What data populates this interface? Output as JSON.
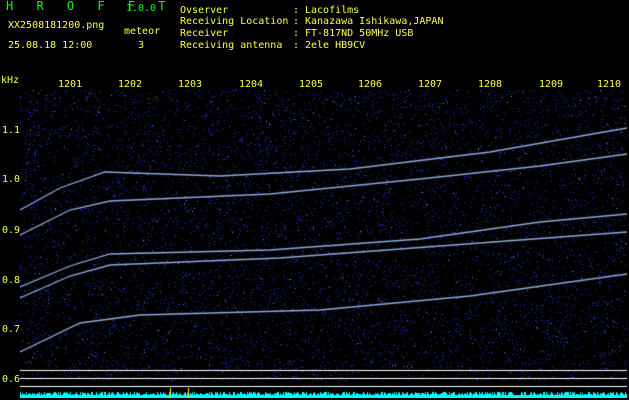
{
  "header": {
    "app_name": "H R O F F T",
    "version": "1.0.0",
    "filename": "XX2508181200.png",
    "meteor_label": "meteor",
    "timestamp": "25.08.18 12:00",
    "meteor_count": "3"
  },
  "info": [
    {
      "label": "Ovserver",
      "value": "Lacofilms"
    },
    {
      "label": "Receiving Location",
      "value": "Kanazawa Ishikawa,JAPAN"
    },
    {
      "label": "Receiver",
      "value": "FT-817ND 50MHz USB"
    },
    {
      "label": "Receiving antenna",
      "value": "2ele HB9CV"
    }
  ],
  "spectrogram": {
    "unit": "kHz",
    "time_ticks": [
      "1201",
      "1202",
      "1203",
      "1204",
      "1205",
      "1206",
      "1207",
      "1208",
      "1209",
      "1210"
    ],
    "freq_ticks": [
      "1.1",
      "1.0",
      "0.9",
      "0.8",
      "0.7",
      "0.6"
    ],
    "colors": {
      "background": "#000000",
      "noise": "#1f35d8",
      "noise_bright": "#6f86ff",
      "trace": "#a9c6ff",
      "text": "#ffff40",
      "title": "#00ff00",
      "baseline": "#00ffff"
    }
  }
}
